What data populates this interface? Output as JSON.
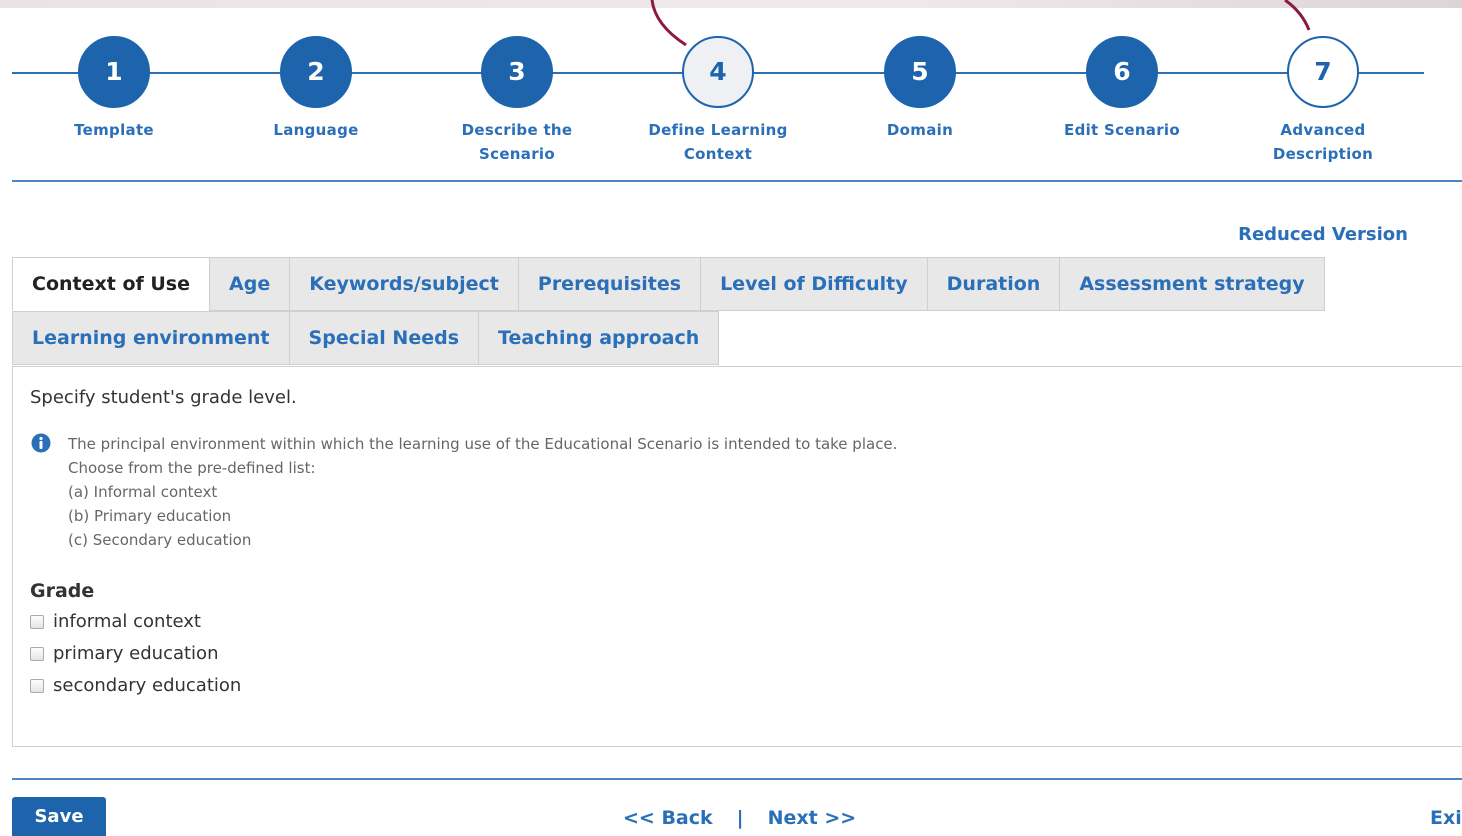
{
  "stepper": {
    "steps": [
      {
        "number": "1",
        "label_line1": "Template",
        "label_line2": ""
      },
      {
        "number": "2",
        "label_line1": "Language",
        "label_line2": ""
      },
      {
        "number": "3",
        "label_line1": "Describe the",
        "label_line2": "Scenario"
      },
      {
        "number": "4",
        "label_line1": "Define Learning",
        "label_line2": "Context"
      },
      {
        "number": "5",
        "label_line1": "Domain",
        "label_line2": ""
      },
      {
        "number": "6",
        "label_line1": "Edit Scenario",
        "label_line2": ""
      },
      {
        "number": "7",
        "label_line1": "Advanced",
        "label_line2": "Description"
      }
    ],
    "current_step": 4
  },
  "reduced_version_label": "Reduced Version",
  "tabs": {
    "row1": [
      "Context of Use",
      "Age",
      "Keywords/subject",
      "Prerequisites",
      "Level of Difficulty",
      "Duration",
      "Assessment strategy"
    ],
    "row2": [
      "Learning environment",
      "Special Needs",
      "Teaching approach"
    ],
    "active": "Context of Use"
  },
  "panel": {
    "instruction": "Specify student's grade level.",
    "help_lines": [
      "The principal environment within which the learning use of the Educational Scenario is intended to take place.",
      "Choose from the pre-defined list:",
      "(a) Informal context",
      "(b) Primary education",
      "(c) Secondary education"
    ],
    "grade_heading": "Grade",
    "options": [
      "informal context",
      "primary education",
      "secondary education"
    ]
  },
  "footer": {
    "save_label": "Save",
    "back_label": "<< Back",
    "separator": "|",
    "next_label": "Next >>",
    "exit_label": "Exit"
  },
  "colors": {
    "primary": "#1d64ad",
    "link": "#2a6fb8",
    "decor_curve": "#8b1a3c"
  },
  "icons": {
    "info": "info-circle-icon"
  }
}
